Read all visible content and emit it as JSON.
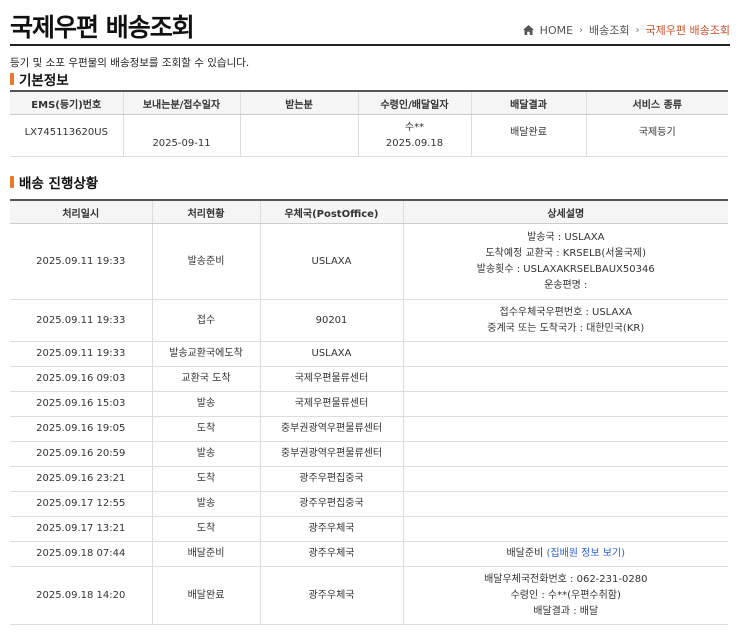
{
  "header": {
    "title": "국제우편 배송조회",
    "breadcrumb": {
      "home": "HOME",
      "level1": "배송조회",
      "current": "국제우편 배송조회"
    }
  },
  "description": "등기 및 소포 우편물의 배송정보를 조회할 수 있습니다.",
  "basic_info": {
    "title": "기본정보",
    "columns": [
      "EMS(등기)번호",
      "보내는분/접수일자",
      "받는분",
      "수령인/배달일자",
      "배달결과",
      "서비스 종류"
    ],
    "row": {
      "number": "LX745113620US",
      "sender_date": "2025-09-11",
      "receiver": "",
      "recipient_name": "수**",
      "recipient_date": "2025.09.18",
      "result": "배달완료",
      "service": "국제등기"
    }
  },
  "progress": {
    "title": "배송 진행상황",
    "columns": [
      "처리일시",
      "처리현황",
      "우체국(PostOffice)",
      "상세설명"
    ],
    "rows": [
      {
        "datetime": "2025.09.11 19:33",
        "status": "발송준비",
        "office": "USLAXA",
        "details": [
          "발송국 : USLAXA",
          "도착예정 교환국 : KRSELB(서울국제)",
          "발송횟수 : USLAXAKRSELBAUX50346",
          "운송편명 :"
        ]
      },
      {
        "datetime": "2025.09.11 19:33",
        "status": "접수",
        "office": "90201",
        "details": [
          "접수우체국우편번호 : USLAXA",
          "중계국 또는 도착국가 : 대한민국(KR)"
        ]
      },
      {
        "datetime": "2025.09.11 19:33",
        "status": "발송교환국에도착",
        "office": "USLAXA",
        "details": []
      },
      {
        "datetime": "2025.09.16 09:03",
        "status": "교환국 도착",
        "office": "국제우편물류센터",
        "details": []
      },
      {
        "datetime": "2025.09.16 15:03",
        "status": "발송",
        "office": "국제우편물류센터",
        "details": []
      },
      {
        "datetime": "2025.09.16 19:05",
        "status": "도착",
        "office": "중부권광역우편물류센터",
        "details": []
      },
      {
        "datetime": "2025.09.16 20:59",
        "status": "발송",
        "office": "중부권광역우편물류센터",
        "details": []
      },
      {
        "datetime": "2025.09.16 23:21",
        "status": "도착",
        "office": "광주우편집중국",
        "details": []
      },
      {
        "datetime": "2025.09.17 12:55",
        "status": "발송",
        "office": "광주우편집중국",
        "details": []
      },
      {
        "datetime": "2025.09.17 13:21",
        "status": "도착",
        "office": "광주우체국",
        "details": []
      },
      {
        "datetime": "2025.09.18 07:44",
        "status": "배달준비",
        "office": "광주우체국",
        "details": [],
        "detail_prefix": "배달준비",
        "detail_link": "(집배원 정보 보기)"
      },
      {
        "datetime": "2025.09.18 14:20",
        "status": "배달완료",
        "office": "광주우체국",
        "details": [
          "배달우체국전화번호 : 062-231-0280",
          "수령인 : 수**(우편수취함)",
          "배달결과 : 배달"
        ]
      }
    ]
  }
}
